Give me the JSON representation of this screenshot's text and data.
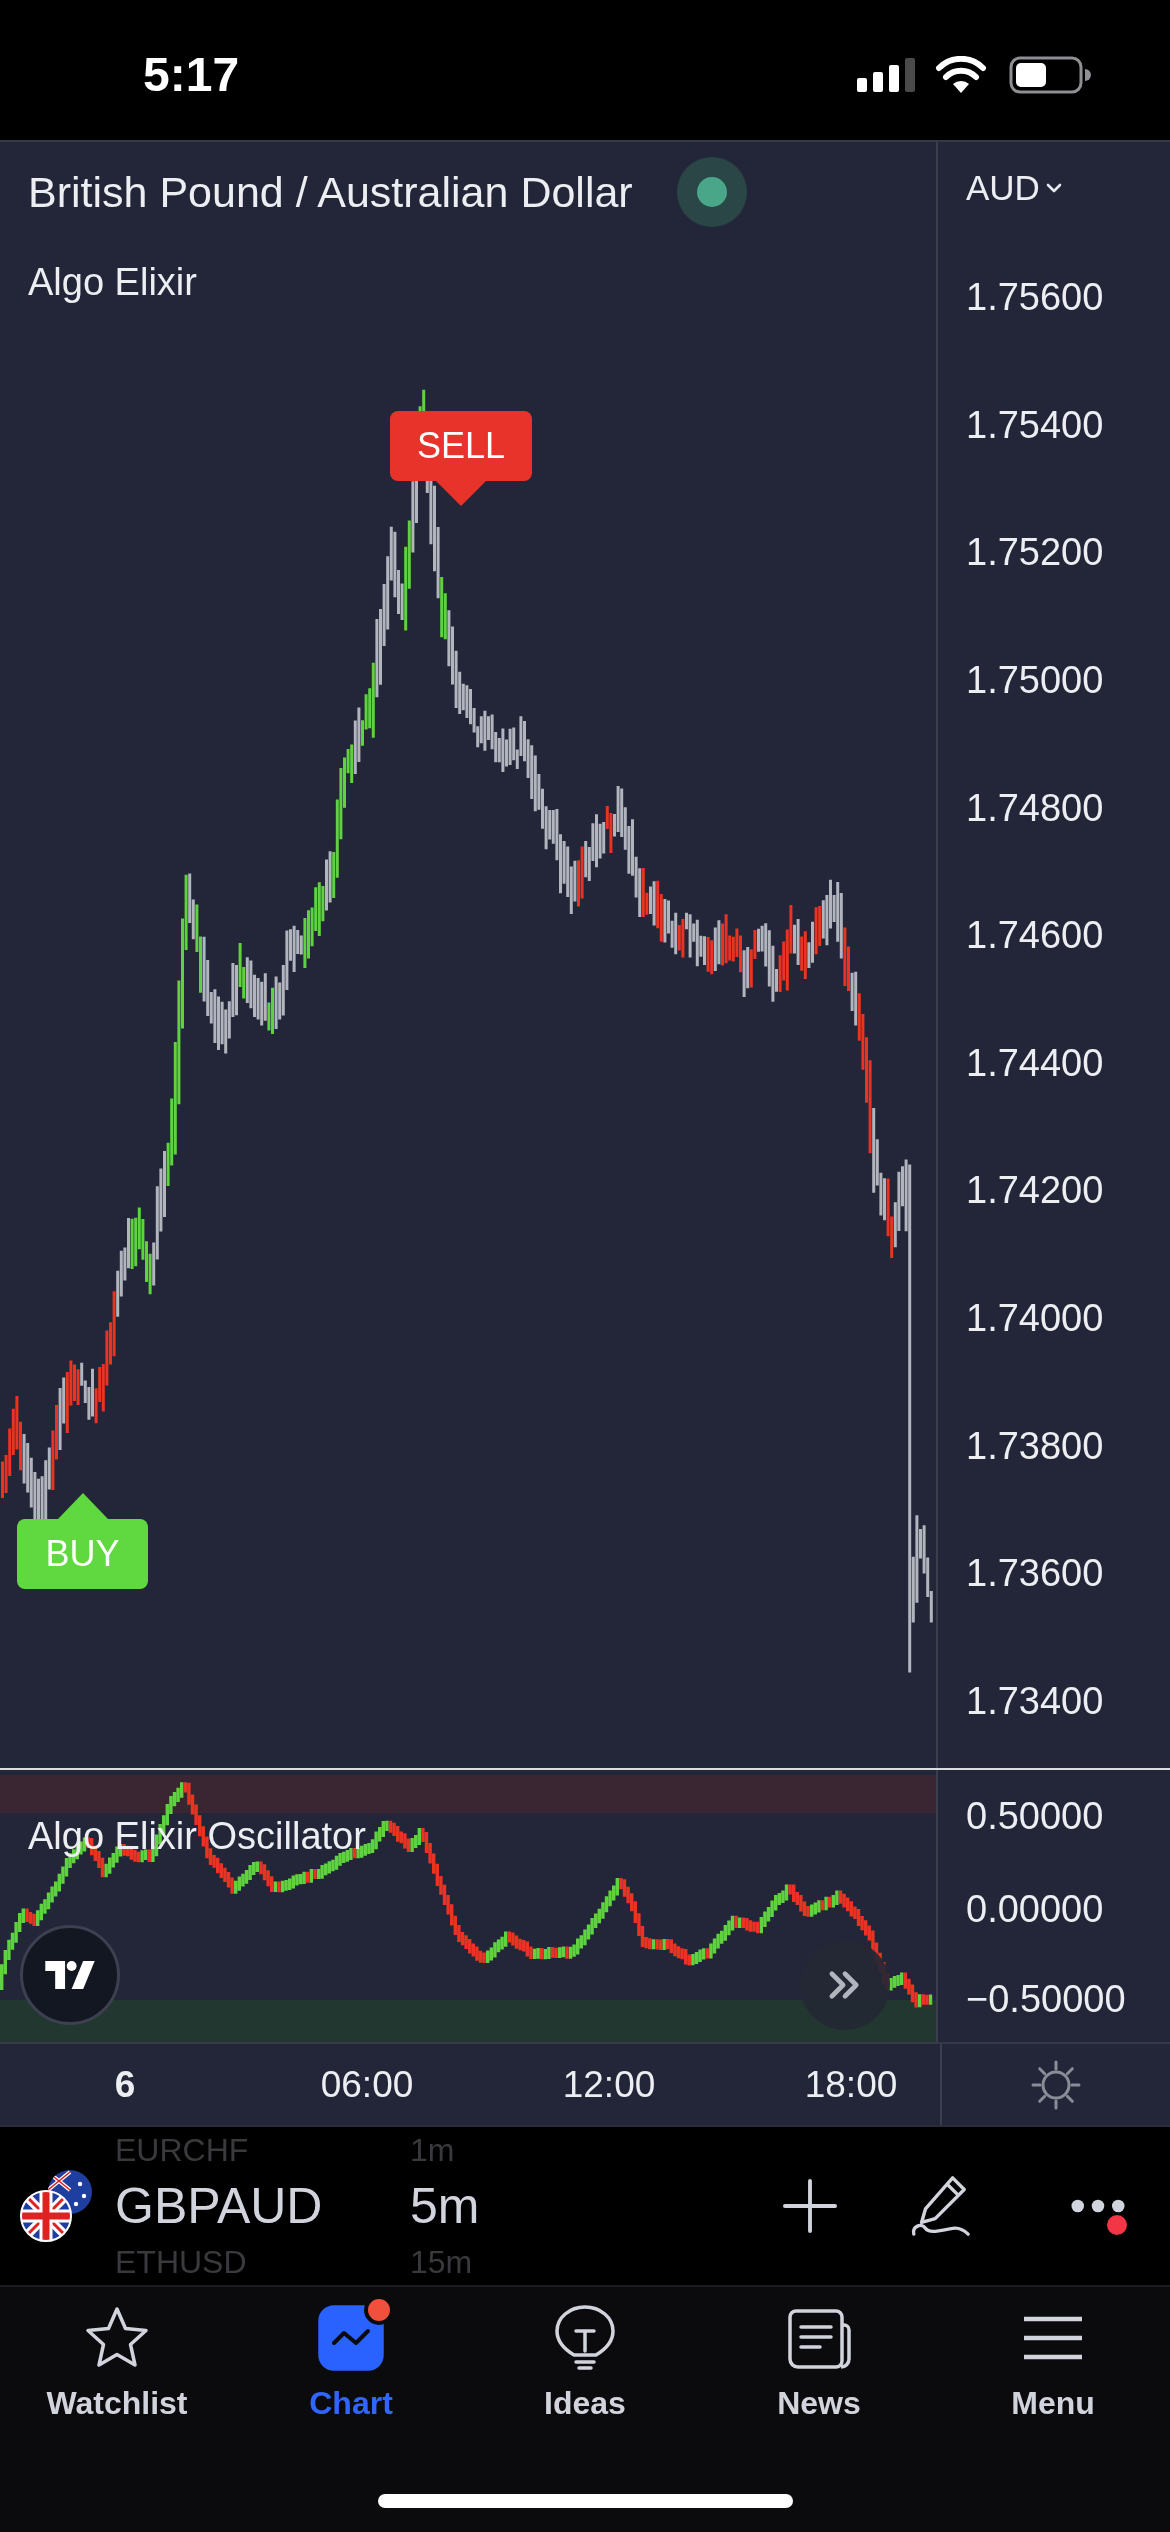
{
  "status_bar": {
    "time": "5:17"
  },
  "chart_header": {
    "title": "British Pound / Australian Dollar",
    "market_open": true,
    "indicator": "Algo Elixir",
    "currency": "AUD"
  },
  "price_axis": {
    "labels": [
      "1.75600",
      "1.75400",
      "1.75200",
      "1.75000",
      "1.74800",
      "1.74600",
      "1.74400",
      "1.74200",
      "1.74000",
      "1.73800",
      "1.73600",
      "1.73400"
    ]
  },
  "signals": [
    {
      "kind": "sell",
      "label": "SELL"
    },
    {
      "kind": "buy",
      "label": "BUY"
    }
  ],
  "oscillator": {
    "title": "Algo Elixir Oscillator",
    "axis_labels": [
      "0.50000",
      "0.00000",
      "−0.50000"
    ]
  },
  "time_axis": {
    "labels": [
      {
        "kind": "date",
        "text": "6"
      },
      {
        "kind": "time",
        "text": "06:00"
      },
      {
        "kind": "time",
        "text": "12:00"
      },
      {
        "kind": "time",
        "text": "18:00"
      }
    ]
  },
  "symbol_picker": {
    "items": [
      {
        "symbol": "EURCHF",
        "interval": "1m",
        "selected": false
      },
      {
        "symbol": "GBPAUD",
        "interval": "5m",
        "selected": true
      },
      {
        "symbol": "ETHUSD",
        "interval": "15m",
        "selected": false
      }
    ]
  },
  "toolbar": {
    "more_notification": true
  },
  "tab_bar": [
    {
      "label": "Watchlist",
      "selected": false,
      "notification": false
    },
    {
      "label": "Chart",
      "selected": true,
      "notification": true
    },
    {
      "label": "Ideas",
      "selected": false,
      "notification": false
    },
    {
      "label": "News",
      "selected": false,
      "notification": false
    },
    {
      "label": "Menu",
      "selected": false,
      "notification": false
    }
  ]
}
